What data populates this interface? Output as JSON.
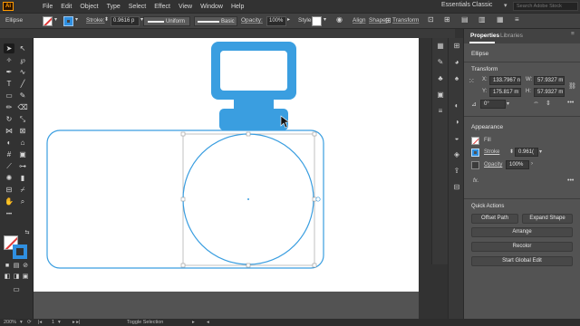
{
  "menubar": {
    "logo": "Ai",
    "items": [
      "File",
      "Edit",
      "Object",
      "Type",
      "Select",
      "Effect",
      "View",
      "Window",
      "Help"
    ],
    "workspace": "Essentials Classic",
    "search_placeholder": "Search Adobe Stock"
  },
  "controlbar": {
    "object_label": "Ellipse",
    "stroke_label": "Stroke:",
    "stroke_value": "0.9616 p",
    "profile_value": "Uniform",
    "brush_value": "Basic",
    "opacity_label": "Opacity:",
    "opacity_value": "100%",
    "style_label": "Style:",
    "align_label": "Align",
    "shape_label": "Shape:",
    "transform_label": "Transform"
  },
  "properties": {
    "tabs": [
      "Properties",
      "Libraries"
    ],
    "object_type": "Ellipse",
    "transform": {
      "title": "Transform",
      "x_label": "X:",
      "x_value": "133.7967 n",
      "y_label": "Y:",
      "y_value": "175.817 m",
      "w_label": "W:",
      "w_value": "57.9327 m",
      "h_label": "H:",
      "h_value": "57.9327 m",
      "angle_value": "0°"
    },
    "appearance": {
      "title": "Appearance",
      "fill_label": "Fill",
      "stroke_label": "Stroke",
      "stroke_value": "0.961(",
      "opacity_label": "Opacity",
      "opacity_value": "100%",
      "fx_label": "fx."
    },
    "quick_actions": {
      "title": "Quick Actions",
      "offset_path": "Offset Path",
      "expand_shape": "Expand Shape",
      "arrange": "Arrange",
      "recolor": "Recolor",
      "start_global_edit": "Start Global Edit"
    }
  },
  "statusbar": {
    "zoom": "200%",
    "artboard_num": "1",
    "mode": "Toggle Selection"
  },
  "colors": {
    "accent": "#3a9ee0",
    "stroke_blue": "#3a9ee0",
    "selection": "#9a9a9a"
  },
  "icons": {
    "toolbar": [
      "selection-arrow-icon",
      "direct-selection-icon",
      "magic-wand-icon",
      "lasso-icon",
      "pen-icon",
      "curvature-icon",
      "type-icon",
      "line-icon",
      "rectangle-icon",
      "paintbrush-icon",
      "pencil-icon",
      "eraser-icon",
      "rotate-icon",
      "scale-icon",
      "width-icon",
      "free-transform-icon",
      "shape-builder-icon",
      "perspective-icon",
      "mesh-icon",
      "gradient-icon",
      "eyedropper-icon",
      "blend-icon",
      "symbol-sprayer-icon",
      "column-graph-icon",
      "artboard-icon",
      "slice-icon",
      "hand-icon",
      "zoom-icon"
    ]
  }
}
